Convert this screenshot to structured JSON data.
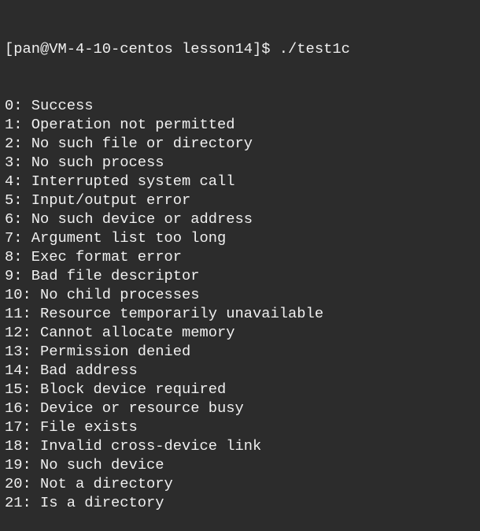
{
  "terminal": {
    "prompt": "[pan@VM-4-10-centos lesson14]$ ./test1c",
    "lines": [
      "0: Success",
      "1: Operation not permitted",
      "2: No such file or directory",
      "3: No such process",
      "4: Interrupted system call",
      "5: Input/output error",
      "6: No such device or address",
      "7: Argument list too long",
      "8: Exec format error",
      "9: Bad file descriptor",
      "10: No child processes",
      "11: Resource temporarily unavailable",
      "12: Cannot allocate memory",
      "13: Permission denied",
      "14: Bad address",
      "15: Block device required",
      "16: Device or resource busy",
      "17: File exists",
      "18: Invalid cross-device link",
      "19: No such device",
      "20: Not a directory",
      "21: Is a directory"
    ]
  }
}
